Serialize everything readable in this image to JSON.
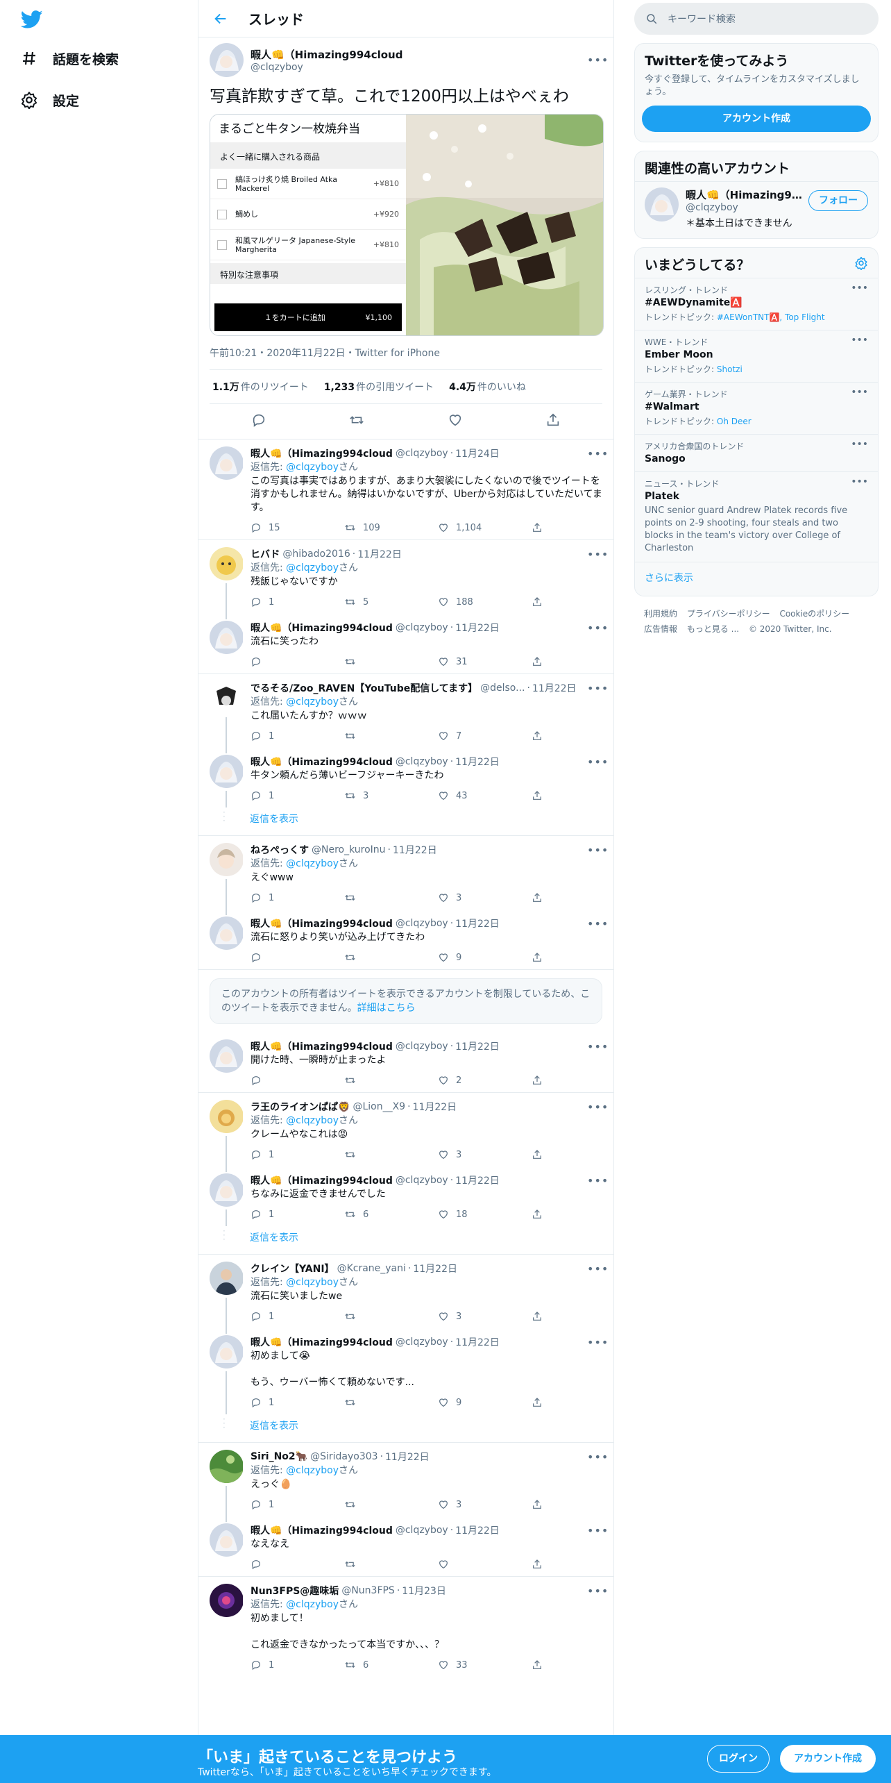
{
  "nav": {
    "explore": "話題を検索",
    "settings": "設定"
  },
  "header": {
    "title": "スレッド"
  },
  "main_tweet": {
    "name": "暇人👊（Himazing994cloud",
    "handle": "@clqzyboy",
    "text": "写真詐欺すぎて草。これで1200円以上はやべぇわ",
    "meta": "午前10:21・2020年11月22日・Twitter for iPhone",
    "retweets_count": "1.1万",
    "retweets_label": "件のリツイート",
    "quotes_count": "1,233",
    "quotes_label": "件の引用ツイート",
    "likes_count": "4.4万",
    "likes_label": "件のいいね",
    "media": {
      "menu_title": "まるごと牛タン一枚焼弁当",
      "section": "よく一緒に購入される商品",
      "items": [
        {
          "name": "縞ほっけ炙り焼 Broiled Atka Mackerel",
          "price": "+¥810"
        },
        {
          "name": "鯛めし",
          "price": "+¥920"
        },
        {
          "name": "和風マルゲリータ Japanese-Style Margherita",
          "price": "+¥810"
        }
      ],
      "notes": "特別な注意事項",
      "cart": "１をカートに追加",
      "cart_price": "¥1,100"
    }
  },
  "reply_label": "返信先:",
  "reply_to": "@clqzyboy",
  "reply_san": "さん",
  "show_replies": "返信を表示",
  "tweets": [
    {
      "name": "暇人👊（Himazing994cloud",
      "handle": "@clqzyboy",
      "date": "11月24日",
      "text": "この写真は事実ではありますが、あまり大袈裟にしたくないので後でツイートを消すかもしれません。納得はいかないですが、Uberから対応はしていただいてます。",
      "reply": "15",
      "rt": "109",
      "like": "1,104"
    },
    {
      "name": "ヒバド",
      "handle": "@hibado2016",
      "date": "11月22日",
      "text": "残飯じゃないですか",
      "reply": "1",
      "rt": "5",
      "like": "188"
    },
    {
      "name": "暇人👊（Himazing994cloud",
      "handle": "@clqzyboy",
      "date": "11月22日",
      "text": "流石に笑ったわ",
      "reply": "",
      "rt": "",
      "like": "31"
    },
    {
      "name": "でるそる/Zoo_RAVEN【YouTube配信してます】",
      "handle": "@delso...",
      "date": "11月22日",
      "text": "これ届いたんすか？ｗｗｗ",
      "reply": "1",
      "rt": "",
      "like": "7"
    },
    {
      "name": "暇人👊（Himazing994cloud",
      "handle": "@clqzyboy",
      "date": "11月22日",
      "text": "牛タン頼んだら薄いビーフジャーキーきたわ",
      "reply": "1",
      "rt": "3",
      "like": "43"
    },
    {
      "name": "ねろぺっくす",
      "handle": "@Nero_kuroInu",
      "date": "11月22日",
      "text": "えぐwww",
      "reply": "1",
      "rt": "",
      "like": "3"
    },
    {
      "name": "暇人👊（Himazing994cloud",
      "handle": "@clqzyboy",
      "date": "11月22日",
      "text": "流石に怒りより笑いが込み上げてきたわ",
      "reply": "",
      "rt": "",
      "like": "9"
    },
    {
      "name": "暇人👊（Himazing994cloud",
      "handle": "@clqzyboy",
      "date": "11月22日",
      "text": "開けた時、一瞬時が止まったよ",
      "reply": "",
      "rt": "",
      "like": "2"
    },
    {
      "name": "ラ王のライオンぱぱ🦁",
      "handle": "@Lion__X9",
      "date": "11月22日",
      "text": "クレームやなこれは😡",
      "reply": "1",
      "rt": "",
      "like": "3"
    },
    {
      "name": "暇人👊（Himazing994cloud",
      "handle": "@clqzyboy",
      "date": "11月22日",
      "text": "ちなみに返金できませんでした",
      "reply": "1",
      "rt": "6",
      "like": "18"
    },
    {
      "name": "クレイン【YANI】",
      "handle": "@Kcrane_yani",
      "date": "11月22日",
      "text": "流石に笑いましたwe",
      "reply": "1",
      "rt": "",
      "like": "3"
    },
    {
      "name": "暇人👊（Himazing994cloud",
      "handle": "@clqzyboy",
      "date": "11月22日",
      "text": "初めまして😭\n\nもう、ウーバー怖くて頼めないです...",
      "reply": "1",
      "rt": "",
      "like": "9"
    },
    {
      "name": "Siri_No2🐂",
      "handle": "@Siridayo303",
      "date": "11月22日",
      "text": "えっぐ🥚",
      "reply": "1",
      "rt": "",
      "like": "3"
    },
    {
      "name": "暇人👊（Himazing994cloud",
      "handle": "@clqzyboy",
      "date": "11月22日",
      "text": "なえなえ",
      "reply": "",
      "rt": "",
      "like": ""
    },
    {
      "name": "Nun3FPS@趣味垢",
      "handle": "@Nun3FPS",
      "date": "11月23日",
      "text": "初めまして！\n\nこれ返金できなかったって本当ですか、、、？",
      "reply": "1",
      "rt": "6",
      "like": "33"
    }
  ],
  "notice": {
    "text": "このアカウントの所有者はツイートを表示できるアカウントを制限しているため、このツイートを表示できません。",
    "link": "詳細はこちら"
  },
  "right": {
    "search_placeholder": "キーワード検索",
    "signup_title": "Twitterを使ってみよう",
    "signup_desc": "今すぐ登録して、タイムラインをカスタマイズしましょう。",
    "signup_button": "アカウント作成",
    "relevant_title": "関連性の高いアカウント",
    "relevant_name": "暇人👊（Himazing99...",
    "relevant_handle": "@clqzyboy",
    "relevant_bio": "＊基本土日はできません",
    "follow": "フォロー",
    "trends_title": "いまどうしてる？",
    "topic_label": "トレンドトピック:",
    "trends": [
      {
        "cat": "レスリング・トレンド",
        "title": "#AEWDynamite🅰️",
        "topic": "#AEWonTNT🅰️, Top Flight"
      },
      {
        "cat": "WWE・トレンド",
        "title": "Ember Moon",
        "topic": "Shotzi"
      },
      {
        "cat": "ゲーム業界・トレンド",
        "title": "#Walmart",
        "topic": "Oh Deer"
      },
      {
        "cat": "アメリカ合衆国のトレンド",
        "title": "Sanogo",
        "topic": ""
      },
      {
        "cat": "ニュース・トレンド",
        "title": "Platek",
        "desc": "UNC senior guard Andrew Platek records five points on 2-9 shooting, four steals and two blocks in the team's victory over College of Charleston"
      }
    ],
    "show_more": "さらに表示",
    "footer": [
      "利用規約",
      "プライバシーポリシー",
      "Cookieのポリシー",
      "広告情報",
      "もっと見る ...",
      "© 2020 Twitter, Inc."
    ]
  },
  "bottom": {
    "title": "「いま」起きていることを見つけよう",
    "subtitle": "Twitterなら、「いま」起きていることをいち早くチェックできます。",
    "login": "ログイン",
    "signup": "アカウント作成"
  },
  "colors": {
    "accent": "#1da1f2",
    "text": "#0f1419",
    "muted": "#5b7083"
  }
}
